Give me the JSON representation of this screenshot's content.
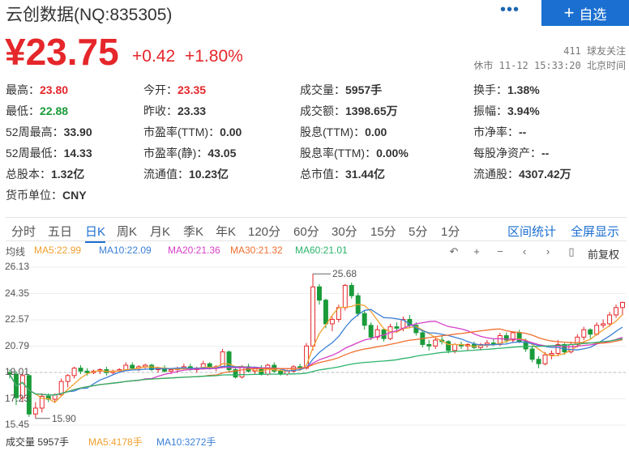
{
  "header": {
    "stock_name": "云创数据(NQ:835305)",
    "more_label": "•••",
    "add_button": {
      "icon": "plus-icon",
      "label": "自选"
    },
    "price": "¥23.75",
    "change": "+0.42",
    "change_pct": "+1.80%",
    "followers": "411 球友关注",
    "status": "休市 11-12 15:33:20 北京时间"
  },
  "stats": [
    {
      "label": "最高：",
      "value": "23.80",
      "tone": "up"
    },
    {
      "label": "今开：",
      "value": "23.35",
      "tone": "up"
    },
    {
      "label": "成交量：",
      "value": "5957手",
      "tone": ""
    },
    {
      "label": "换手：",
      "value": "1.38%",
      "tone": ""
    },
    {
      "label": "最低：",
      "value": "22.88",
      "tone": "down"
    },
    {
      "label": "昨收：",
      "value": "23.33",
      "tone": ""
    },
    {
      "label": "成交额：",
      "value": "1398.65万",
      "tone": ""
    },
    {
      "label": "振幅：",
      "value": "3.94%",
      "tone": ""
    },
    {
      "label": "52周最高：",
      "value": "33.90",
      "tone": ""
    },
    {
      "label": "市盈率(TTM)：",
      "value": "0.00",
      "tone": ""
    },
    {
      "label": "股息(TTM)：",
      "value": "0.00",
      "tone": ""
    },
    {
      "label": "市净率：",
      "value": "--",
      "tone": ""
    },
    {
      "label": "52周最低：",
      "value": "14.33",
      "tone": ""
    },
    {
      "label": "市盈率(静)：",
      "value": "43.05",
      "tone": ""
    },
    {
      "label": "股息率(TTM)：",
      "value": "0.00%",
      "tone": ""
    },
    {
      "label": "每股净资产：",
      "value": "--",
      "tone": ""
    },
    {
      "label": "总股本：",
      "value": "1.32亿",
      "tone": ""
    },
    {
      "label": "流通值：",
      "value": "10.23亿",
      "tone": ""
    },
    {
      "label": "总市值：",
      "value": "31.44亿",
      "tone": ""
    },
    {
      "label": "流通股：",
      "value": "4307.42万",
      "tone": ""
    },
    {
      "label": "货币单位：",
      "value": "CNY",
      "tone": ""
    }
  ],
  "tabs": [
    "分时",
    "五日",
    "日K",
    "周K",
    "月K",
    "季K",
    "年K",
    "120分",
    "60分",
    "30分",
    "15分",
    "5分",
    "1分"
  ],
  "active_tab": "日K",
  "tab_links": [
    "区间统计",
    "全屏显示"
  ],
  "ma_legend": [
    {
      "label": "均线",
      "color": "#555555"
    },
    {
      "label": "MA5:22.99",
      "color": "#f0a030"
    },
    {
      "label": "MA10:22.09",
      "color": "#3a7fd5"
    },
    {
      "label": "MA20:21.36",
      "color": "#d63fc7"
    },
    {
      "label": "MA30:21.32",
      "color": "#f07030"
    },
    {
      "label": "MA60:21.01",
      "color": "#2bb36b"
    }
  ],
  "controls": [
    {
      "icon": "undo-icon",
      "glyph": "↶"
    },
    {
      "icon": "zoom-in-icon",
      "glyph": "+"
    },
    {
      "icon": "zoom-out-icon",
      "glyph": "−"
    },
    {
      "icon": "scroll-left-icon",
      "glyph": "‹"
    },
    {
      "icon": "scroll-right-icon",
      "glyph": "›"
    },
    {
      "icon": "lock-icon",
      "glyph": "▯"
    }
  ],
  "adjust_label": "前复权",
  "volume_footer": [
    {
      "label": "成交量 5957手",
      "color": "#333333"
    },
    {
      "label": "MA5:4178手",
      "color": "#f0a030"
    },
    {
      "label": "MA10:3272手",
      "color": "#3a7fd5"
    }
  ],
  "colors": {
    "up": "#e5262a",
    "down": "#1a9b3a",
    "accent": "#1b6fd1"
  },
  "chart_data": {
    "type": "candlestick",
    "y_ticks": [
      "26.13",
      "24.35",
      "22.57",
      "20.79",
      "19.01",
      "17.23",
      "15.45"
    ],
    "ylim": [
      15.45,
      26.13
    ],
    "grid": true,
    "annotations": [
      {
        "text": "25.68",
        "kind": "high"
      },
      {
        "text": "15.90",
        "kind": "low"
      }
    ],
    "ohlc": [
      [
        19.0,
        19.2,
        18.6,
        18.9
      ],
      [
        18.9,
        19.1,
        16.8,
        17.3
      ],
      [
        17.3,
        19.0,
        17.0,
        18.8
      ],
      [
        18.8,
        18.9,
        16.0,
        16.2
      ],
      [
        16.2,
        17.0,
        15.9,
        16.6
      ],
      [
        16.6,
        17.6,
        16.3,
        17.4
      ],
      [
        17.4,
        17.6,
        17.0,
        17.2
      ],
      [
        17.2,
        17.6,
        17.0,
        17.5
      ],
      [
        17.5,
        18.6,
        17.4,
        18.4
      ],
      [
        18.4,
        18.9,
        18.0,
        18.8
      ],
      [
        18.8,
        19.4,
        18.6,
        19.3
      ],
      [
        19.3,
        19.5,
        18.9,
        19.1
      ],
      [
        19.1,
        19.3,
        18.8,
        19.0
      ],
      [
        19.0,
        19.2,
        18.9,
        19.1
      ],
      [
        19.1,
        19.3,
        18.9,
        19.2
      ],
      [
        19.2,
        19.4,
        18.8,
        19.0
      ],
      [
        19.0,
        19.2,
        18.9,
        19.1
      ],
      [
        19.1,
        19.3,
        19.0,
        19.2
      ],
      [
        19.2,
        19.7,
        19.1,
        19.5
      ],
      [
        19.5,
        19.7,
        19.2,
        19.3
      ],
      [
        19.3,
        19.5,
        19.1,
        19.4
      ],
      [
        19.4,
        19.6,
        19.2,
        19.5
      ],
      [
        19.5,
        19.6,
        19.1,
        19.2
      ],
      [
        19.2,
        19.4,
        19.0,
        19.3
      ],
      [
        19.3,
        19.5,
        19.0,
        19.1
      ],
      [
        19.1,
        19.3,
        18.9,
        19.2
      ],
      [
        19.2,
        19.4,
        19.0,
        19.3
      ],
      [
        19.3,
        19.6,
        19.2,
        19.4
      ],
      [
        19.4,
        19.6,
        19.1,
        19.2
      ],
      [
        19.2,
        19.4,
        19.0,
        19.3
      ],
      [
        19.3,
        19.8,
        19.2,
        19.6
      ],
      [
        19.6,
        19.7,
        19.2,
        19.3
      ],
      [
        19.3,
        19.5,
        19.1,
        19.4
      ],
      [
        19.4,
        20.6,
        19.3,
        20.4
      ],
      [
        20.4,
        20.5,
        19.0,
        19.2
      ],
      [
        19.2,
        19.4,
        18.6,
        18.7
      ],
      [
        18.7,
        19.5,
        18.6,
        19.4
      ],
      [
        19.4,
        19.6,
        19.0,
        19.1
      ],
      [
        19.1,
        19.4,
        18.9,
        19.3
      ],
      [
        19.3,
        19.5,
        18.8,
        18.9
      ],
      [
        18.9,
        19.6,
        18.8,
        19.5
      ],
      [
        19.5,
        19.7,
        19.0,
        19.1
      ],
      [
        19.1,
        19.3,
        18.8,
        18.9
      ],
      [
        18.9,
        19.2,
        18.8,
        19.1
      ],
      [
        19.1,
        19.5,
        19.0,
        19.4
      ],
      [
        19.4,
        19.6,
        19.2,
        19.3
      ],
      [
        19.3,
        21.0,
        19.2,
        20.8
      ],
      [
        20.8,
        25.68,
        20.5,
        24.8
      ],
      [
        24.8,
        25.0,
        23.6,
        23.9
      ],
      [
        23.9,
        24.0,
        22.0,
        22.3
      ],
      [
        22.3,
        22.8,
        21.8,
        22.6
      ],
      [
        22.6,
        23.6,
        22.4,
        23.4
      ],
      [
        23.4,
        25.0,
        23.2,
        24.9
      ],
      [
        24.9,
        25.1,
        24.0,
        24.2
      ],
      [
        24.2,
        24.4,
        22.8,
        23.0
      ],
      [
        23.0,
        23.2,
        21.9,
        22.2
      ],
      [
        22.2,
        22.4,
        21.2,
        21.4
      ],
      [
        21.4,
        22.2,
        21.2,
        21.9
      ],
      [
        21.9,
        22.0,
        21.1,
        21.3
      ],
      [
        21.3,
        22.3,
        21.2,
        22.1
      ],
      [
        22.1,
        22.4,
        21.7,
        22.0
      ],
      [
        22.0,
        22.8,
        21.8,
        22.6
      ],
      [
        22.6,
        22.9,
        22.0,
        22.2
      ],
      [
        22.2,
        22.4,
        21.5,
        21.7
      ],
      [
        21.7,
        21.9,
        20.7,
        20.9
      ],
      [
        20.9,
        21.2,
        20.5,
        20.8
      ],
      [
        20.8,
        21.4,
        20.6,
        21.2
      ],
      [
        21.2,
        21.5,
        20.9,
        21.1
      ],
      [
        21.1,
        21.2,
        20.3,
        20.5
      ],
      [
        20.5,
        21.0,
        20.3,
        20.9
      ],
      [
        20.9,
        21.1,
        20.6,
        20.8
      ],
      [
        20.8,
        21.0,
        20.5,
        20.9
      ],
      [
        20.9,
        21.1,
        20.6,
        20.7
      ],
      [
        20.7,
        21.0,
        20.5,
        20.9
      ],
      [
        20.9,
        21.2,
        20.7,
        21.0
      ],
      [
        21.0,
        21.3,
        20.8,
        20.9
      ],
      [
        20.9,
        21.7,
        20.8,
        21.5
      ],
      [
        21.5,
        21.7,
        21.0,
        21.2
      ],
      [
        21.2,
        21.8,
        21.0,
        21.7
      ],
      [
        21.7,
        21.9,
        21.0,
        21.1
      ],
      [
        21.1,
        21.3,
        20.4,
        20.6
      ],
      [
        20.6,
        20.8,
        19.7,
        19.9
      ],
      [
        19.9,
        20.1,
        19.3,
        19.6
      ],
      [
        19.6,
        20.4,
        19.5,
        20.2
      ],
      [
        20.2,
        20.5,
        19.9,
        20.3
      ],
      [
        20.3,
        21.2,
        20.1,
        20.9
      ],
      [
        20.9,
        21.0,
        20.2,
        20.4
      ],
      [
        20.4,
        21.1,
        20.3,
        20.9
      ],
      [
        20.9,
        21.6,
        20.7,
        21.4
      ],
      [
        21.4,
        22.1,
        21.2,
        21.9
      ],
      [
        21.9,
        22.0,
        21.3,
        21.6
      ],
      [
        21.6,
        22.4,
        21.5,
        22.2
      ],
      [
        22.2,
        22.6,
        22.0,
        22.3
      ],
      [
        22.3,
        23.1,
        22.1,
        22.9
      ],
      [
        22.9,
        23.6,
        22.7,
        23.4
      ],
      [
        23.4,
        23.8,
        22.88,
        23.75
      ]
    ]
  }
}
